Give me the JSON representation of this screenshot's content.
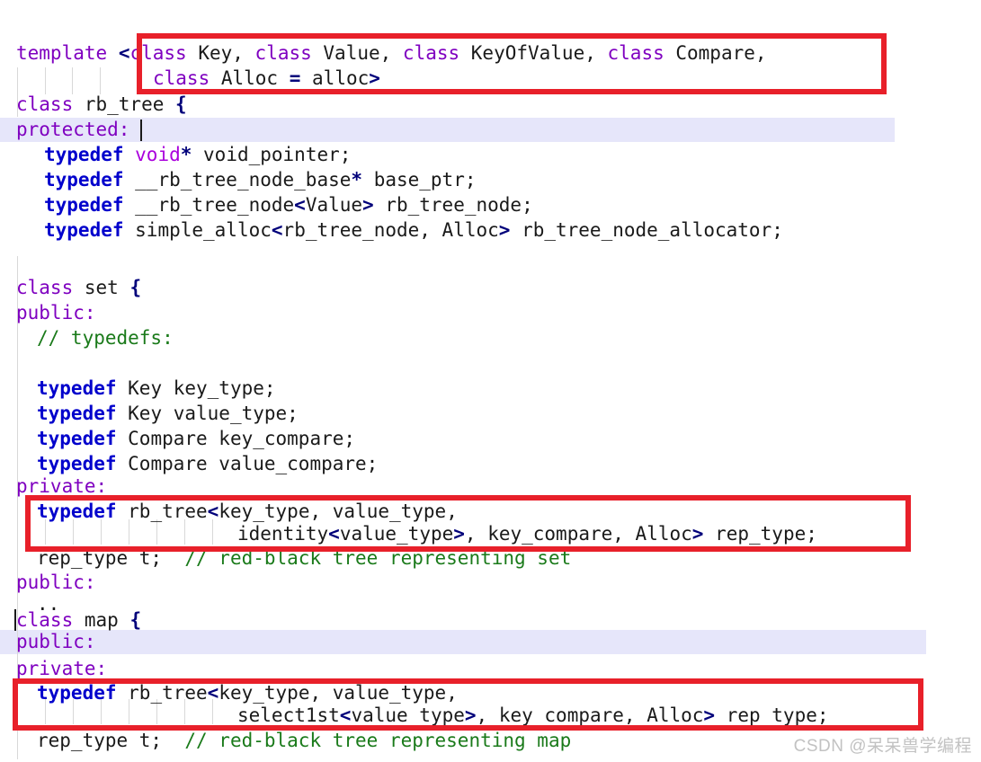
{
  "editor": {
    "language": "cpp",
    "background_color": "#ffffff",
    "highlight_color": "#e6e6fa",
    "annotation_color": "#e8202a",
    "colors": {
      "keyword": "#7f00c0",
      "typedef_keyword": "#0000cc",
      "builtin_type": "#aa00dd",
      "operator": "#00007a",
      "comment": "#1a7a1a",
      "plain_text": "#1a1a1a"
    }
  },
  "code": {
    "line01": {
      "kw_template": "template",
      "op_open": "<",
      "kw_class1": "class",
      "name_key": " Key, ",
      "kw_class2": "class",
      "name_value": " Value, ",
      "kw_class3": "class",
      "name_keyofvalue": " KeyOfValue, ",
      "kw_class4": "class",
      "name_compare": " Compare,"
    },
    "line02": {
      "kw_class": "class",
      "name_alloc": " Alloc ",
      "op_eq": "=",
      "name_allocval": " alloc",
      "op_close": ">"
    },
    "line03": {
      "kw_class": "class",
      "name": " rb_tree ",
      "op_brace": "{"
    },
    "line04": {
      "kw_protected": "protected:"
    },
    "line05": {
      "kw_typedef": "typedef",
      "type_void": " void",
      "op_star": "*",
      "name": " void_pointer;"
    },
    "line06": {
      "kw_typedef": "typedef",
      "name": " __rb_tree_node_base",
      "op_star": "*",
      "name2": " base_ptr;"
    },
    "line07": {
      "kw_typedef": "typedef",
      "name": " __rb_tree_node",
      "op_lt": "<",
      "name2": "Value",
      "op_gt": ">",
      "name3": " rb_tree_node;"
    },
    "line08": {
      "kw_typedef": "typedef",
      "name": " simple_alloc",
      "op_lt": "<",
      "name2": "rb_tree_node, Alloc",
      "op_gt": ">",
      "name3": " rb_tree_node_allocator;"
    },
    "line10": {
      "kw_class": "class",
      "name": " set ",
      "op_brace": "{"
    },
    "line11": {
      "kw_public": "public:"
    },
    "line12": {
      "comment": "// typedefs:"
    },
    "line14": {
      "kw_typedef": "typedef",
      "name": " Key key_type;"
    },
    "line15": {
      "kw_typedef": "typedef",
      "name": " Key value_type;"
    },
    "line16": {
      "kw_typedef": "typedef",
      "name": " Compare key_compare;"
    },
    "line17": {
      "kw_typedef": "typedef",
      "name": " Compare value_compare;"
    },
    "line18": {
      "kw_private": "private:"
    },
    "line19": {
      "kw_typedef": "typedef",
      "name": " rb_tree",
      "op_lt": "<",
      "name2": "key_type, value_type,"
    },
    "line20": {
      "name": "identity",
      "op_lt": "<",
      "name2": "value_type",
      "op_gt": ">",
      "name3": ", key_compare, Alloc",
      "op_gt2": ">",
      "name4": " rep_type;"
    },
    "line21": {
      "name": "rep_type t;  ",
      "comment": "// red-black tree representing set"
    },
    "line22": {
      "kw_public": "public:"
    },
    "line23": {
      "name": ".."
    },
    "line24": {
      "kw_class": "class",
      "name": " map ",
      "op_brace": "{"
    },
    "line25": {
      "kw_public": "public:"
    },
    "line26": {
      "kw_private": "private:"
    },
    "line27": {
      "kw_typedef": "typedef",
      "name": " rb_tree",
      "op_lt": "<",
      "name2": "key_type, value_type,"
    },
    "line28": {
      "name": "select1st",
      "op_lt": "<",
      "name2": "value_type",
      "op_gt": ">",
      "name3": ", key_compare, Alloc",
      "op_gt2": ">",
      "name4": " rep_type;"
    },
    "line29": {
      "name": "rep_type t;  ",
      "comment": "// red-black tree representing map"
    }
  },
  "annotations": {
    "box_template_params": {
      "label": "template-parameter-list-highlight"
    },
    "box_set_rep_type": {
      "label": "set-rep-type-highlight"
    },
    "box_map_rep_type": {
      "label": "map-rep-type-highlight"
    }
  },
  "watermark": {
    "text": "CSDN @呆呆兽学编程"
  }
}
